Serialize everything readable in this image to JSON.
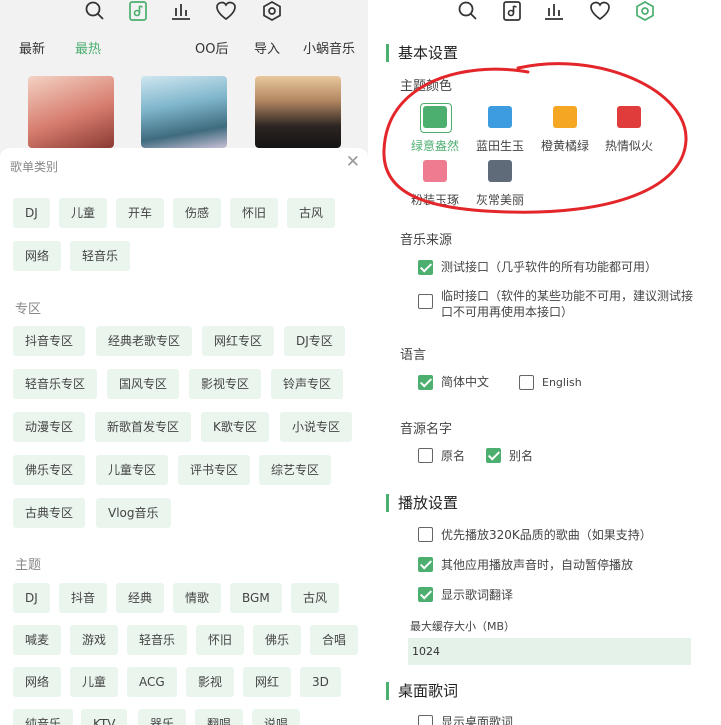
{
  "accent": "#4caf6f",
  "left": {
    "nav": [
      "最新",
      "最热",
      "OO后",
      "导入",
      "小蜗音乐"
    ],
    "active_nav": "最热",
    "sheet": {
      "title": "歌单类别",
      "close_icon": "close-icon",
      "group1": [
        "DJ",
        "儿童",
        "开车",
        "伤感",
        "怀旧",
        "古风",
        "网络",
        "轻音乐"
      ],
      "zone_title": "专区",
      "zones": [
        "抖音专区",
        "经典老歌专区",
        "网红专区",
        "DJ专区",
        "轻音乐专区",
        "国风专区",
        "影视专区",
        "铃声专区",
        "动漫专区",
        "新歌首发专区",
        "K歌专区",
        "小说专区",
        "佛乐专区",
        "儿童专区",
        "评书专区",
        "综艺专区",
        "古典专区",
        "Vlog音乐"
      ],
      "theme_title": "主题",
      "themes": [
        "DJ",
        "抖音",
        "经典",
        "情歌",
        "BGM",
        "古风",
        "喊麦",
        "游戏",
        "轻音乐",
        "怀旧",
        "佛乐",
        "合唱",
        "网络",
        "儿童",
        "ACG",
        "影视",
        "网红",
        "3D",
        "纯音乐",
        "KTV",
        "器乐",
        "翻唱",
        "说唱"
      ]
    }
  },
  "right": {
    "basic_title": "基本设置",
    "theme_color_label": "主题颜色",
    "themes": [
      {
        "name": "绿意盎然",
        "color": "#4caf6f",
        "selected": true
      },
      {
        "name": "蓝田生玉",
        "color": "#3d9be0",
        "selected": false
      },
      {
        "name": "橙黄橘绿",
        "color": "#f5a623",
        "selected": false
      },
      {
        "name": "热情似火",
        "color": "#e03c3c",
        "selected": false
      },
      {
        "name": "粉装玉琢",
        "color": "#ee7b8f",
        "selected": false
      },
      {
        "name": "灰常美丽",
        "color": "#5f6b78",
        "selected": false
      }
    ],
    "music_source_label": "音乐来源",
    "source_test": "测试接口（几乎软件的所有功能都可用）",
    "source_temp_line1": "临时接口（软件的某些功能不可用，建议测试接",
    "source_temp_line2": "口不可用再使用本接口）",
    "language_label": "语言",
    "lang_zh": "简体中文",
    "lang_en": "English",
    "source_name_label": "音源名字",
    "name_original": "原名",
    "name_alias": "别名",
    "play_title": "播放设置",
    "play_opt1": "优先播放320K品质的歌曲（如果支持）",
    "play_opt2": "其他应用播放声音时，自动暂停播放",
    "play_opt3": "显示歌词翻译",
    "cache_label": "最大缓存大小（MB）",
    "cache_value": "1024",
    "desktop_lyric_title": "桌面歌词",
    "desktop_lyric_opt": "显示桌面歌词"
  }
}
